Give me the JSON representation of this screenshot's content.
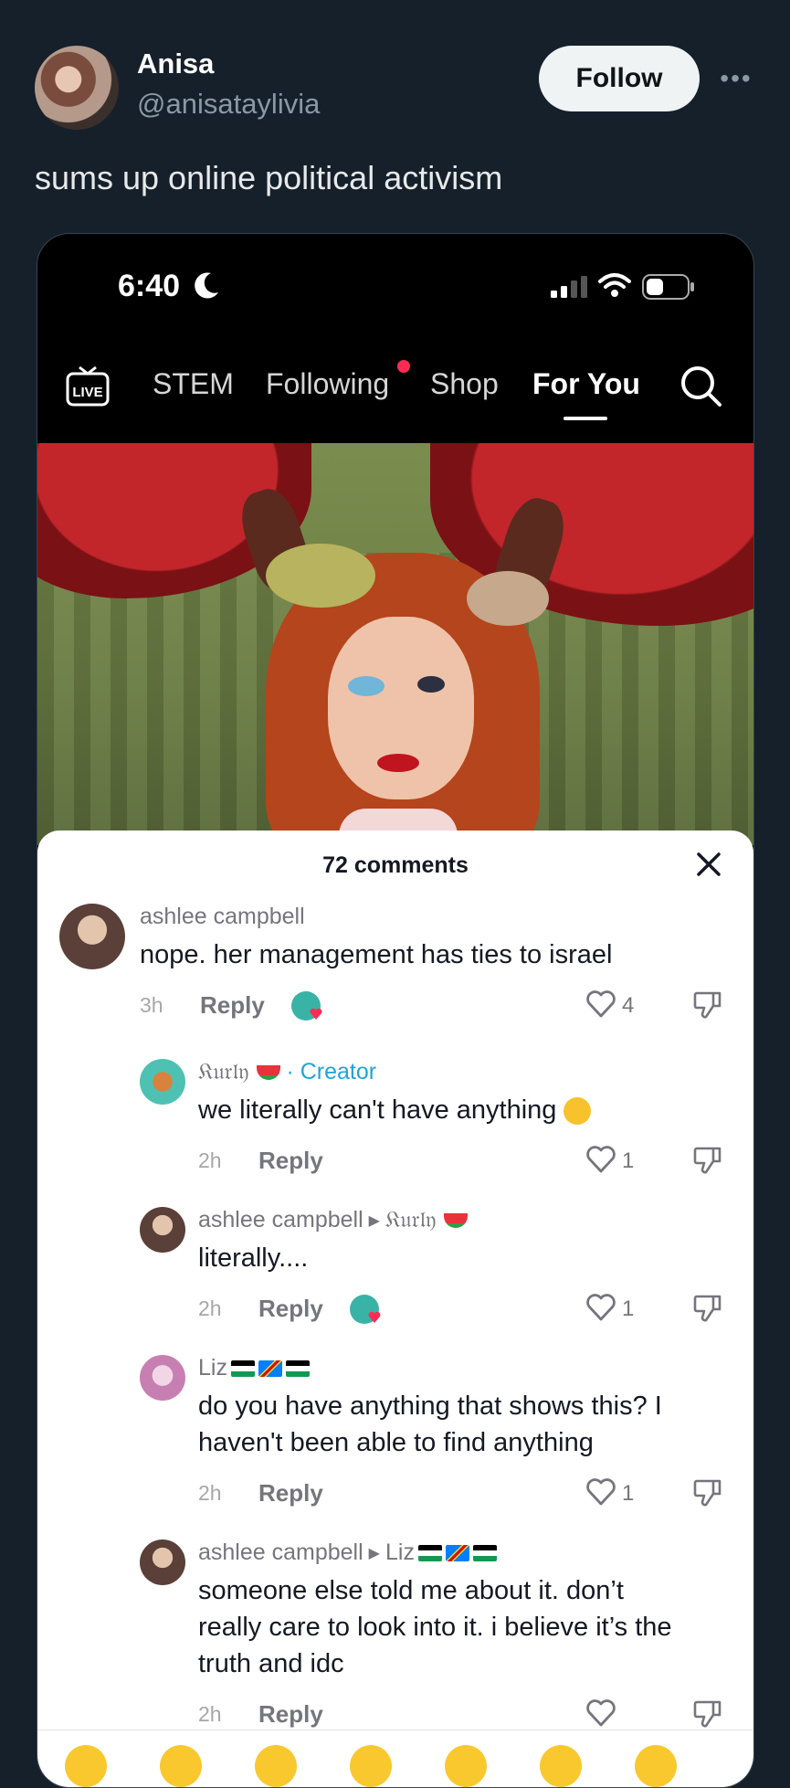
{
  "tweet": {
    "author_name": "Anisa",
    "author_handle": "@anisataylivia",
    "follow_label": "Follow",
    "more_label": "•••",
    "text": "sums up online political activism"
  },
  "phone": {
    "time": "6:40",
    "nav": {
      "live_label": "LIVE",
      "tabs": [
        "STEM",
        "Following",
        "Shop",
        "For You"
      ],
      "active_tab": "For You"
    }
  },
  "comments_panel": {
    "count_label": "72 comments",
    "comments": [
      {
        "name": "ashlee campbell",
        "text": "nope. her management has ties to israel",
        "time": "3h",
        "reply_label": "Reply",
        "likes": "4"
      },
      {
        "name": "𝔎𝔲𝔯𝔩𝔶",
        "creator_label": "· Creator",
        "text": "we literally can't have anything",
        "time": "2h",
        "reply_label": "Reply",
        "likes": "1"
      },
      {
        "name": "ashlee campbell",
        "reply_to": "𝔎𝔲𝔯𝔩𝔶",
        "text": "literally....",
        "time": "2h",
        "reply_label": "Reply",
        "likes": "1"
      },
      {
        "name": "Liz",
        "text_line1": "do you have anything that shows this? I",
        "text_line2": "haven't been able to find anything",
        "time": "2h",
        "reply_label": "Reply",
        "likes": "1"
      },
      {
        "name": "ashlee campbell",
        "reply_to": "Liz",
        "text_line1": "someone else told me about it. don’t",
        "text_line2": "really care to look into it. i believe it’s the",
        "text_line3": "truth and idc",
        "time": "2h",
        "reply_label": "Reply"
      }
    ]
  }
}
